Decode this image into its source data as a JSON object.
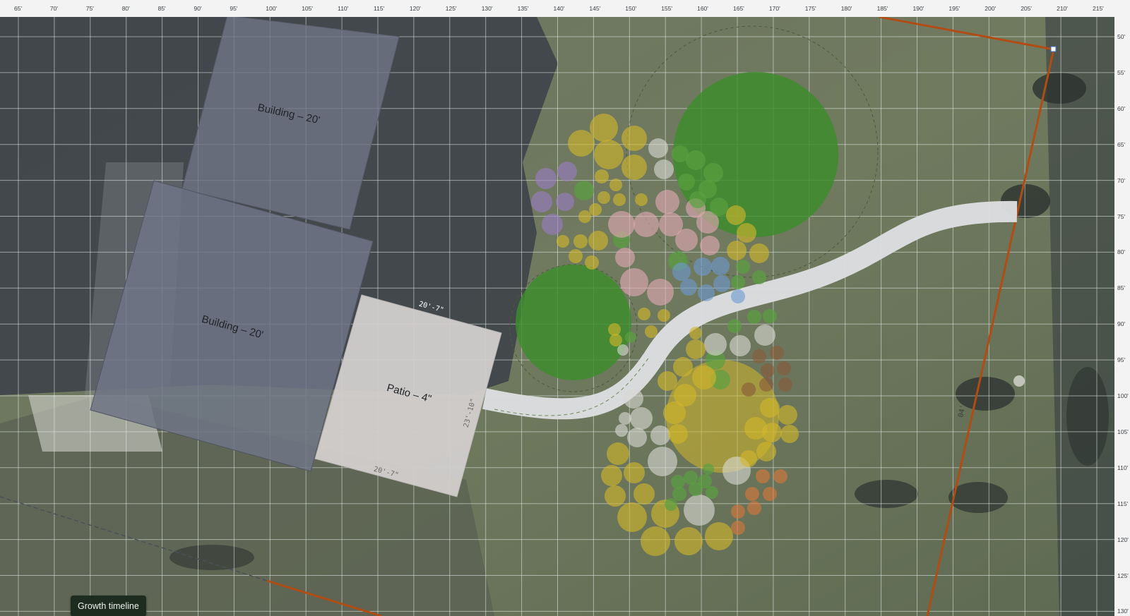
{
  "ruler": {
    "x_labels": [
      "65'",
      "70'",
      "75'",
      "80'",
      "85'",
      "90'",
      "95'",
      "100'",
      "105'",
      "110'",
      "115'",
      "120'",
      "125'",
      "130'",
      "135'",
      "140'",
      "145'",
      "150'",
      "155'",
      "160'",
      "165'",
      "170'",
      "175'",
      "180'",
      "185'",
      "190'",
      "195'",
      "200'",
      "205'",
      "210'",
      "215'"
    ],
    "y_labels": [
      "50'",
      "55'",
      "60'",
      "65'",
      "70'",
      "75'",
      "80'",
      "85'",
      "90'",
      "95'",
      "100'",
      "105'",
      "110'",
      "115'",
      "120'",
      "125'",
      "130'"
    ]
  },
  "structures": {
    "building_upper_label": "Building – 20'",
    "building_lower_label": "Building – 20'",
    "patio_label": "Patio – 4\"",
    "patio_dim_top": "20'-7\"",
    "patio_dim_bottom": "20'-7\"",
    "patio_dim_side": "23'-10\""
  },
  "colors": {
    "property_line": "#b04c14",
    "grid_line": "#e6ecea",
    "building": "#6f7686",
    "patio": "#d2cfcd",
    "path": "#dcdde0",
    "tree": "#3c8c2c",
    "shrub_yellow": "#d2b62a",
    "shrub_pink": "#e3a9b4",
    "shrub_purple": "#9a7cc4",
    "shrub_blue": "#6e9ad0",
    "shrub_green": "#5aa040",
    "shrub_white": "#d8d8d2",
    "shrub_orange": "#d9783a",
    "shrub_brown": "#8a5a3a"
  },
  "toolbar": {
    "growth_timeline_label": "Growth timeline"
  }
}
